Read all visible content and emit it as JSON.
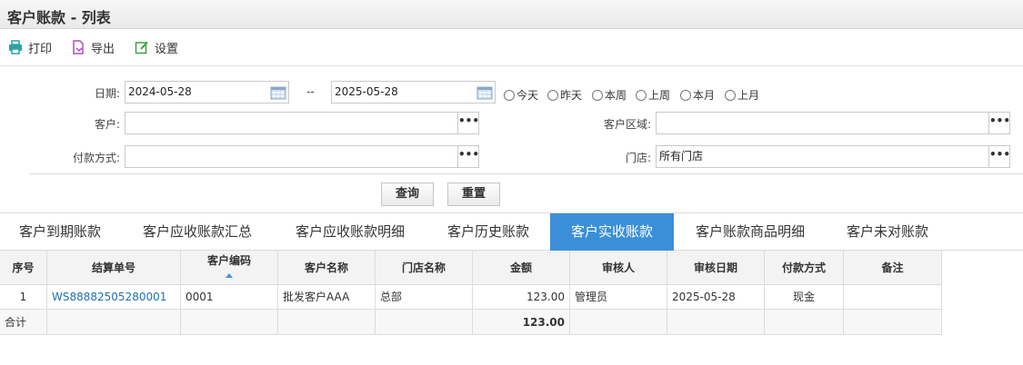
{
  "window": {
    "title": "客户账款 - 列表"
  },
  "toolbar": {
    "print_label": "打印",
    "export_label": "导出",
    "settings_label": "设置"
  },
  "filters": {
    "date_label": "日期:",
    "date_from": "2024-05-28",
    "date_sep": "--",
    "date_to": "2025-05-28",
    "quick_dates": [
      "今天",
      "昨天",
      "本周",
      "上周",
      "本月",
      "上月"
    ],
    "customer_label": "客户:",
    "customer_value": "",
    "region_label": "客户区域:",
    "region_value": "",
    "payment_label": "付款方式:",
    "payment_value": "",
    "store_label": "门店:",
    "store_value": "所有门店",
    "dots": "•••"
  },
  "actions": {
    "query_label": "查询",
    "reset_label": "重置"
  },
  "tabs": [
    {
      "label": "客户到期账款"
    },
    {
      "label": "客户应收账款汇总"
    },
    {
      "label": "客户应收账款明细"
    },
    {
      "label": "客户历史账款"
    },
    {
      "label": "客户实收账款",
      "active": true
    },
    {
      "label": "客户账款商品明细"
    },
    {
      "label": "客户未对账款"
    }
  ],
  "table": {
    "columns": [
      "序号",
      "结算单号",
      "客户编码",
      "客户名称",
      "门店名称",
      "金额",
      "审核人",
      "审核日期",
      "付款方式",
      "备注"
    ],
    "rows": [
      [
        "1",
        "WS88882505280001",
        "0001",
        "批发客户AAA",
        "总部",
        "123.00",
        "管理员",
        "2025-05-28",
        "现金",
        ""
      ]
    ],
    "summary": {
      "label": "合计",
      "amount": "123.00"
    }
  },
  "colors": {
    "accent": "#3b8fd8",
    "link": "#1f6fb5"
  }
}
